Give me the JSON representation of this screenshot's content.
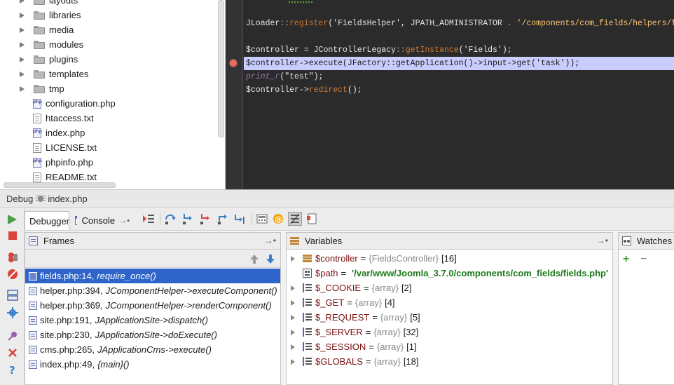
{
  "project_tree": {
    "top_partial": "layouts",
    "items": [
      {
        "label": "libraries",
        "kind": "folder"
      },
      {
        "label": "media",
        "kind": "folder"
      },
      {
        "label": "modules",
        "kind": "folder"
      },
      {
        "label": "plugins",
        "kind": "folder"
      },
      {
        "label": "templates",
        "kind": "folder"
      },
      {
        "label": "tmp",
        "kind": "folder"
      },
      {
        "label": "configuration.php",
        "kind": "php"
      },
      {
        "label": "htaccess.txt",
        "kind": "text"
      },
      {
        "label": "index.php",
        "kind": "php"
      },
      {
        "label": "LICENSE.txt",
        "kind": "text"
      },
      {
        "label": "phpinfo.php",
        "kind": "php"
      },
      {
        "label": "README.txt",
        "kind": "text"
      }
    ]
  },
  "editor": {
    "lines": [
      {
        "tokens": [
          {
            "t": "JLoader",
            "c": "#e6e6e6"
          },
          {
            "t": "::",
            "c": "#b0b0b0"
          },
          {
            "t": "register",
            "c": "#cc7832"
          },
          {
            "t": "('",
            "c": "#e6e6e6"
          },
          {
            "t": "FieldsHelper",
            "c": "#e6e6e6"
          },
          {
            "t": "', ",
            "c": "#e6e6e6"
          },
          {
            "t": "JPATH_ADMINISTRATOR",
            "c": "#e6e6e6"
          },
          {
            "t": " . ",
            "c": "#b0b0b0"
          },
          {
            "t": "'/components/com_fields/helpers/fields.php'",
            "c": "#ffc66d"
          },
          {
            "t": ");",
            "c": "#e6e6e6"
          }
        ]
      },
      {
        "tokens": []
      },
      {
        "tokens": [
          {
            "t": "$controller",
            "c": "#e6e6e6"
          },
          {
            "t": " = ",
            "c": "#e6e6e6"
          },
          {
            "t": "JControllerLegacy",
            "c": "#e6e6e6"
          },
          {
            "t": "::",
            "c": "#b0b0b0"
          },
          {
            "t": "getInstance",
            "c": "#cc7832"
          },
          {
            "t": "('",
            "c": "#e6e6e6"
          },
          {
            "t": "Fields",
            "c": "#e6e6e6"
          },
          {
            "t": "');",
            "c": "#e6e6e6"
          }
        ]
      },
      {
        "tokens": [
          {
            "t": "$controller->execute(JFactory::getApplication()->input->get('task'));",
            "c": "#1a1a1a"
          }
        ],
        "highlight": true
      },
      {
        "tokens": [
          {
            "t": "print_r",
            "c": "#9876aa"
          },
          {
            "t": "(\"",
            "c": "#e6e6e6"
          },
          {
            "t": "test",
            "c": "#e6e6e6"
          },
          {
            "t": "\");",
            "c": "#e6e6e6"
          }
        ]
      },
      {
        "tokens": [
          {
            "t": "$controller",
            "c": "#e6e6e6"
          },
          {
            "t": "->",
            "c": "#e6e6e6"
          },
          {
            "t": "redirect",
            "c": "#cc7832"
          },
          {
            "t": "();",
            "c": "#e6e6e6"
          }
        ]
      }
    ]
  },
  "debug": {
    "title": "Debug",
    "config": "index.php",
    "tabs": {
      "debugger": "Debugger",
      "console": "Console"
    },
    "frames": {
      "title": "Frames",
      "rows": [
        {
          "file": "fields.php:14,",
          "fn": "require_once()"
        },
        {
          "file": "helper.php:394,",
          "fn": "JComponentHelper->executeComponent()"
        },
        {
          "file": "helper.php:369,",
          "fn": "JComponentHelper->renderComponent()"
        },
        {
          "file": "site.php:191,",
          "fn": "JApplicationSite->dispatch()"
        },
        {
          "file": "site.php:230,",
          "fn": "JApplicationSite->doExecute()"
        },
        {
          "file": "cms.php:265,",
          "fn": "JApplicationCms->execute()"
        },
        {
          "file": "index.php:49,",
          "fn": "{main}()"
        }
      ]
    },
    "variables": {
      "title": "Variables",
      "rows": [
        {
          "name": "$controller",
          "type": "{FieldsController}",
          "value": "[16]",
          "icon": "object",
          "expandable": true
        },
        {
          "name": "$path",
          "type": "",
          "value": "'/var/www/Joomla_3.7.0/components/com_fields/fields.php'",
          "icon": "string",
          "expandable": false
        },
        {
          "name": "$_COOKIE",
          "type": "{array}",
          "value": "[2]",
          "icon": "array",
          "expandable": true
        },
        {
          "name": "$_GET",
          "type": "{array}",
          "value": "[4]",
          "icon": "array",
          "expandable": true
        },
        {
          "name": "$_REQUEST",
          "type": "{array}",
          "value": "[5]",
          "icon": "array",
          "expandable": true
        },
        {
          "name": "$_SERVER",
          "type": "{array}",
          "value": "[32]",
          "icon": "array",
          "expandable": true
        },
        {
          "name": "$_SESSION",
          "type": "{array}",
          "value": "[1]",
          "icon": "array",
          "expandable": true
        },
        {
          "name": "$GLOBALS",
          "type": "{array}",
          "value": "[18]",
          "icon": "array",
          "expandable": true
        }
      ]
    },
    "watches": {
      "title": "Watches",
      "add": "+",
      "remove": "−"
    }
  },
  "colors": {
    "selection": "#2f65ca",
    "exec_line": "#c9cdfe",
    "breakpoint": "#e06c63"
  }
}
